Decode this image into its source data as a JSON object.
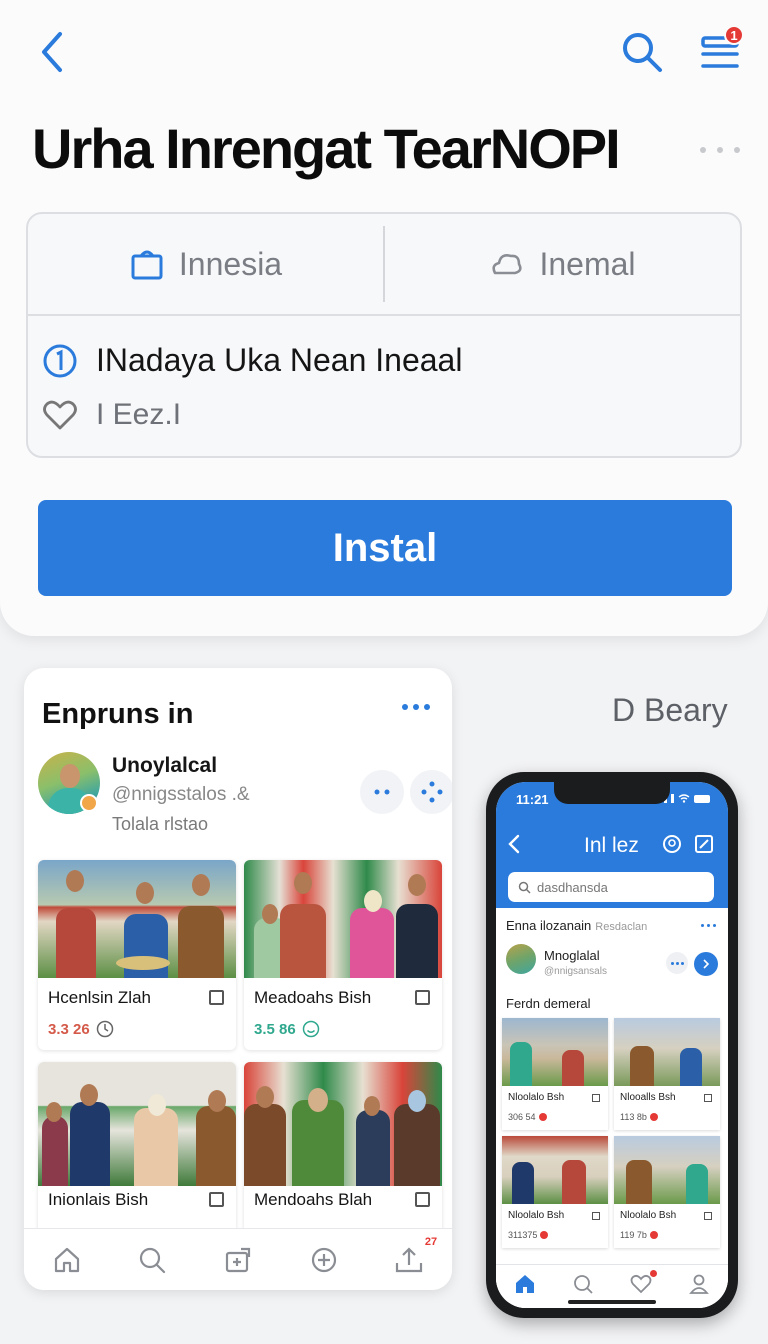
{
  "header": {
    "back_icon": "chevron-left-icon",
    "search_icon": "search-icon",
    "menu_icon": "list-icon",
    "menu_badge": "1",
    "title": "Urha Inrengat TearNOPI"
  },
  "info_card": {
    "tab_left": {
      "label": "Innesia",
      "icon": "bag-icon"
    },
    "tab_right": {
      "label": "Inemal",
      "icon": "cloud-icon"
    },
    "line1": {
      "icon": "info-icon",
      "text": "INadaya Uka Nean Ineaal"
    },
    "line2": {
      "icon": "heart-icon",
      "text": "I Eez.I"
    }
  },
  "install_button": {
    "label": "Instal"
  },
  "feed": {
    "title": "Enpruns in",
    "profile": {
      "name": "Unoylalcal",
      "handle": "@nnigsstalos .&",
      "subtitle": "Tolala rlstao"
    },
    "posts": [
      {
        "caption": "Hcenlsin Zlah",
        "stat": "3.3 26",
        "stat_color": "#d45a4a",
        "stat_icon": "clock-icon"
      },
      {
        "caption": "Meadoahs Bish",
        "stat": "3.5 86",
        "stat_color": "#2fa88e",
        "stat_icon": "smile-icon"
      },
      {
        "caption": "Inionlais Bish",
        "stat": ""
      },
      {
        "caption": "Mendoahs Blah",
        "stat": ""
      }
    ],
    "tabbar": {
      "home_icon": "home-icon",
      "search_icon": "search-icon",
      "create_icon": "add-box-icon",
      "plus_icon": "plus-circle-icon",
      "upload_icon": "upload-icon",
      "upload_badge": "27"
    }
  },
  "side_label": "D Beary",
  "phone": {
    "time": "11:21",
    "title": "Inl lez",
    "search_placeholder": "dasdhansda",
    "section_title": "Enna ilozanain",
    "section_sub": "Resdaclan",
    "profile_name": "Mnoglalal",
    "profile_handle": "@nnigsansals",
    "feed_title": "Ferdn demeral",
    "posts": [
      {
        "caption": "Nloolalo Bsh",
        "stat": "306 54"
      },
      {
        "caption": "Nlooalls Bsh",
        "stat": "113 8b"
      },
      {
        "caption": "Nloolalo Bsh",
        "stat": "311375"
      },
      {
        "caption": "Nloolalo Bsh",
        "stat": "119 7b"
      }
    ]
  }
}
